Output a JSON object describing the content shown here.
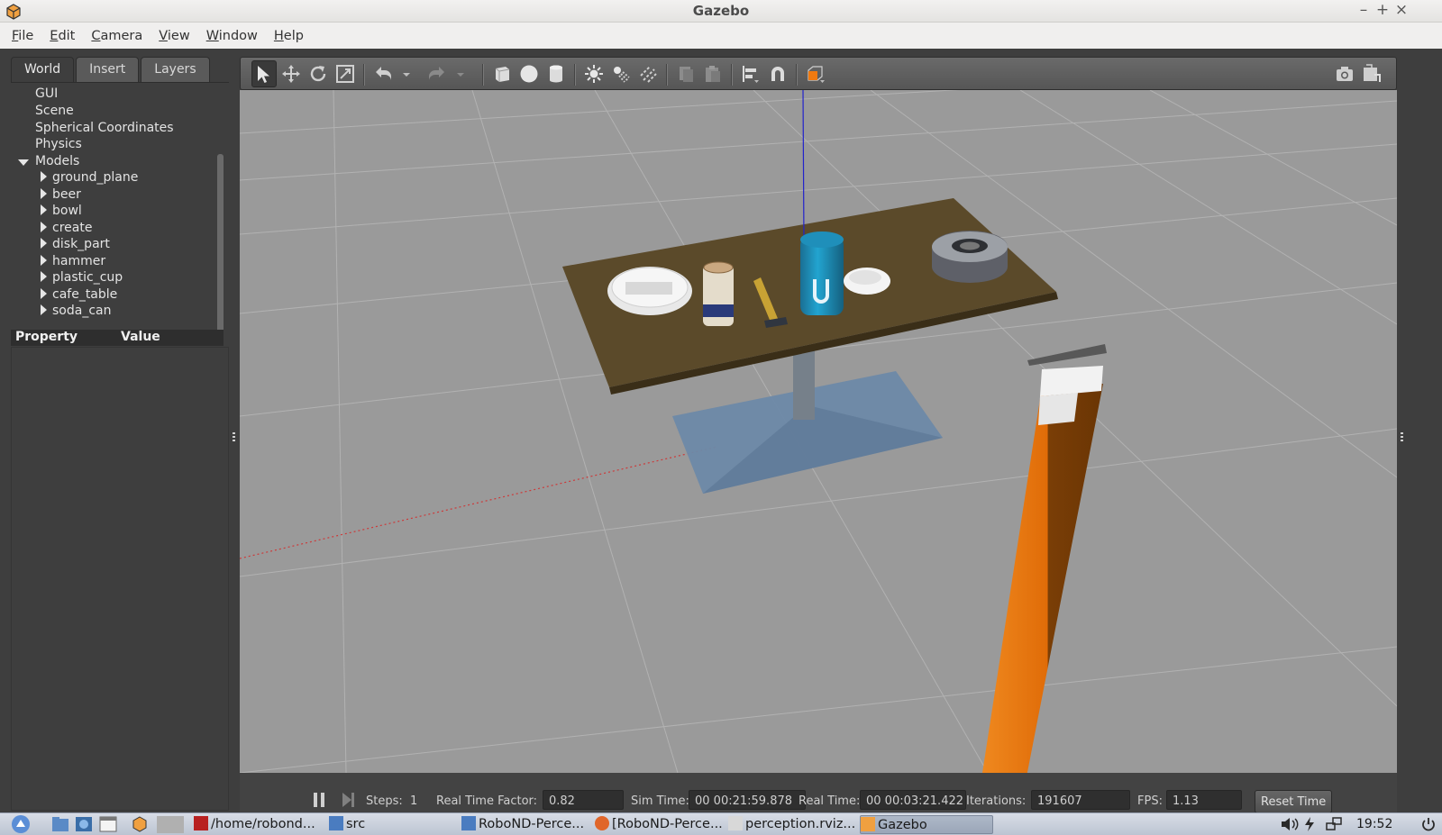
{
  "window": {
    "title": "Gazebo",
    "minimize": "–",
    "maximize": "+",
    "close": "×"
  },
  "menu": [
    "File",
    "Edit",
    "Camera",
    "View",
    "Window",
    "Help"
  ],
  "left_panel": {
    "tabs": [
      "World",
      "Insert",
      "Layers"
    ],
    "active_tab": "World",
    "tree": {
      "top_items": [
        "GUI",
        "Scene",
        "Spherical Coordinates",
        "Physics"
      ],
      "models_label": "Models",
      "models": [
        "ground_plane",
        "beer",
        "bowl",
        "create",
        "disk_part",
        "hammer",
        "plastic_cup",
        "cafe_table",
        "soda_can"
      ]
    },
    "property_header": {
      "property": "Property",
      "value": "Value"
    }
  },
  "toolbar": {
    "tools": [
      "select-arrow-icon",
      "translate-icon",
      "rotate-icon",
      "scale-icon",
      "undo-icon",
      "undo-dropdown-icon",
      "redo-icon",
      "redo-dropdown-icon",
      "box-shape-icon",
      "sphere-shape-icon",
      "cylinder-shape-icon",
      "point-light-icon",
      "spot-light-icon",
      "directional-light-icon",
      "copy-icon",
      "paste-icon",
      "align-icon",
      "snap-icon",
      "view-angle-icon",
      "screenshot-icon",
      "log-icon"
    ]
  },
  "statusbar": {
    "steps_label": "Steps:",
    "steps_value": "1",
    "rtf_label": "Real Time Factor:",
    "rtf_value": "0.82",
    "sim_time_label": "Sim Time:",
    "sim_time_value": "00 00:21:59.878",
    "real_time_label": "Real Time:",
    "real_time_value": "00 00:03:21.422",
    "iterations_label": "Iterations:",
    "iterations_value": "191607",
    "fps_label": "FPS:",
    "fps_value": "1.13",
    "reset_label": "Reset Time"
  },
  "taskbar": {
    "items": [
      "/home/robond...",
      "src",
      "RoboND-Perce...",
      "[RoboND-Perce...",
      "perception.rviz...",
      "Gazebo"
    ],
    "active_item": "Gazebo",
    "clock": "19:52"
  },
  "colors": {
    "viewport_gray": "#9a9a9a",
    "table_top": "#5b4a2a",
    "arm_orange": "#e3720e",
    "soda_can": "#1e90b8",
    "x_axis": "#d03030",
    "z_axis": "#2020d0"
  }
}
